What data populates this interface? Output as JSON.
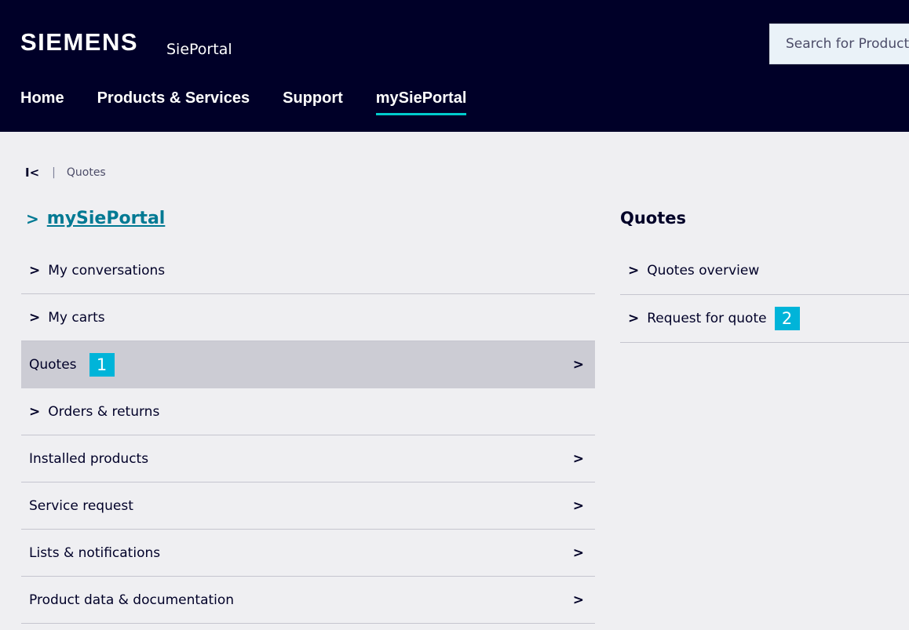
{
  "header": {
    "brand": "SIEMENS",
    "portal_name": "SiePortal",
    "search_placeholder": "Search for Products",
    "nav": [
      {
        "label": "Home",
        "active": false
      },
      {
        "label": "Products & Services",
        "active": false
      },
      {
        "label": "Support",
        "active": false
      },
      {
        "label": "mySiePortal",
        "active": true
      }
    ]
  },
  "breadcrumb": {
    "home_icon": "first-page-icon",
    "separator": "|",
    "current": "Quotes"
  },
  "left_menu": {
    "section_title": "mySiePortal",
    "items": [
      {
        "label": "My conversations",
        "chevron": "lead"
      },
      {
        "label": "My carts",
        "chevron": "lead"
      },
      {
        "label": "Quotes",
        "chevron": "trail",
        "selected": true,
        "marker": "1"
      },
      {
        "label": "Orders & returns",
        "chevron": "lead"
      },
      {
        "label": "Installed products",
        "chevron": "trail"
      },
      {
        "label": "Service request",
        "chevron": "trail"
      },
      {
        "label": "Lists & notifications",
        "chevron": "trail"
      },
      {
        "label": "Product data & documentation",
        "chevron": "trail"
      }
    ]
  },
  "right_panel": {
    "title": "Quotes",
    "items": [
      {
        "label": "Quotes overview"
      },
      {
        "label": "Request for quote",
        "marker": "2"
      }
    ]
  },
  "colors": {
    "header_bg": "#000028",
    "accent_teal": "#007993",
    "nav_underline": "#00cccc",
    "marker_bg": "#00b4d9",
    "selected_bg": "#ccccd4",
    "page_bg": "#efeff2"
  }
}
